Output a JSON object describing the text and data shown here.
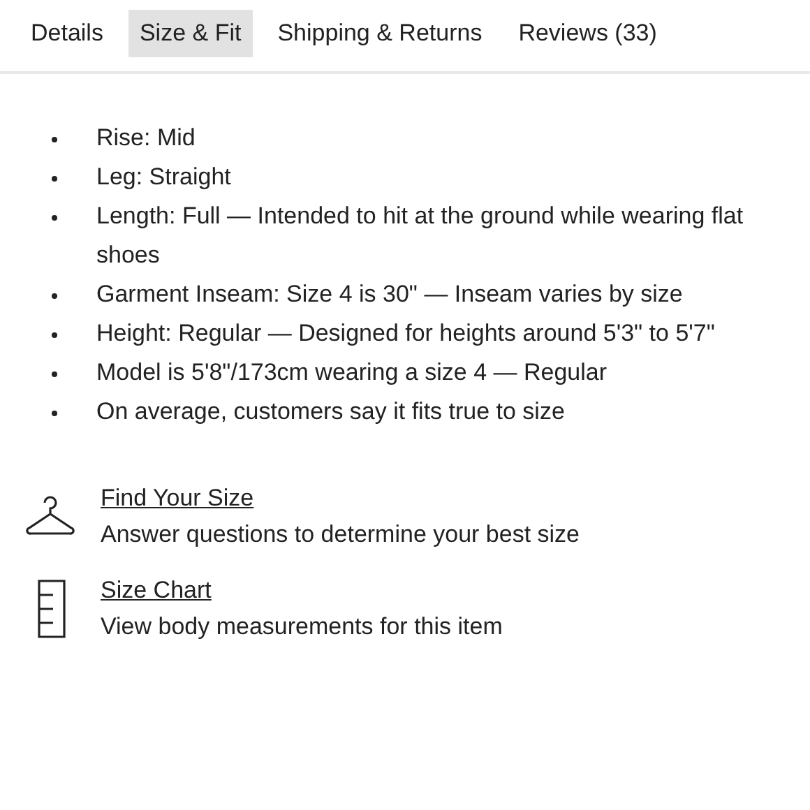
{
  "tabs": [
    {
      "label": "Details",
      "selected": false
    },
    {
      "label": "Size & Fit",
      "selected": true
    },
    {
      "label": "Shipping & Returns",
      "selected": false
    },
    {
      "label": "Reviews (33)",
      "selected": false
    }
  ],
  "fit_details": [
    "Rise: Mid",
    "Leg: Straight",
    "Length: Full — Intended to hit at the ground while wearing flat shoes",
    "Garment Inseam: Size 4 is 30\" — Inseam varies by size",
    "Height: Regular — Designed for heights around 5'3\" to 5'7\"",
    "Model is 5'8\"/173cm wearing a size 4  —  Regular",
    "On average, customers say it fits true to size"
  ],
  "tools": [
    {
      "kind": "hanger",
      "link": "Find Your Size",
      "description": "Answer questions to determine your best size"
    },
    {
      "kind": "ruler",
      "link": "Size Chart",
      "description": "View body measurements for this item"
    }
  ]
}
